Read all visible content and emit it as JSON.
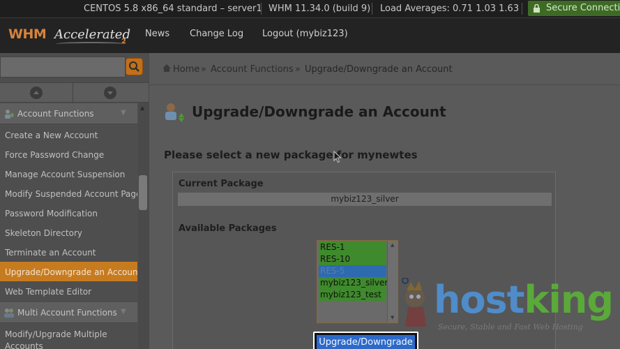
{
  "statusbar": {
    "server": "CENTOS 5.8 x86_64 standard – server1",
    "version": "WHM 11.34.0 (build 9)",
    "load": "Load Averages: 0.71 1.03 1.63",
    "secure": "Secure Connection"
  },
  "navbar": {
    "logo_main": "WHM",
    "logo_accent": "Accelerated",
    "logo_num": "2",
    "links": [
      "News",
      "Change Log",
      "Logout (mybiz123)"
    ]
  },
  "sidebar": {
    "search_placeholder": "",
    "sections": [
      {
        "label": "Account Functions"
      },
      {
        "label": "Multi Account Functions"
      }
    ],
    "items": [
      "Create a New Account",
      "Force Password Change",
      "Manage Account Suspension",
      "Modify Suspended Account Page",
      "Password Modification",
      "Skeleton Directory",
      "Terminate an Account",
      "Upgrade/Downgrade an Account",
      "Web Template Editor"
    ],
    "multi_item": "Modify/Upgrade Multiple Accounts",
    "active_index": 7
  },
  "breadcrumb": [
    "Home",
    "»",
    "Account Functions",
    "»",
    "Upgrade/Downgrade an Account"
  ],
  "page": {
    "title": "Upgrade/Downgrade an Account",
    "prompt": "Please select a new package for mynewtes",
    "current_label": "Current Package",
    "current_value": "mybiz123_silver",
    "available_label": "Available Packages",
    "packages": [
      "RES-1",
      "RES-10",
      "RES-5",
      "mybiz123_silver",
      "mybiz123_test"
    ],
    "selected_package": "RES-5",
    "submit_label": "Upgrade/Downgrade"
  },
  "watermark": {
    "brand_a": "host",
    "brand_b": "king",
    "tagline": "Secure, Stable and Fast Web Hosting"
  },
  "colors": {
    "accent_orange": "#c77b1f",
    "secure_green": "#3d6b26",
    "option_green": "#3f8a2c",
    "option_selected": "#2d6ab0",
    "button_blue": "#2c6ac9"
  }
}
